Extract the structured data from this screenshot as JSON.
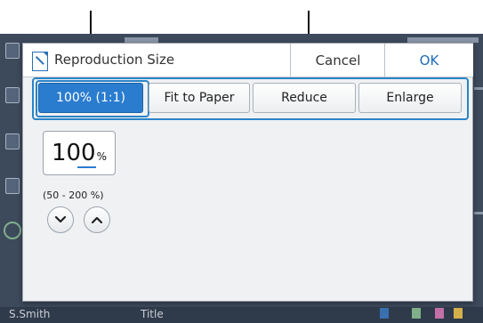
{
  "dialog": {
    "title": "Reproduction Size",
    "cancel_label": "Cancel",
    "ok_label": "OK"
  },
  "options": [
    {
      "label": "100% (1:1)",
      "selected": true
    },
    {
      "label": "Fit to Paper",
      "selected": false
    },
    {
      "label": "Reduce",
      "selected": false
    },
    {
      "label": "Enlarge",
      "selected": false
    }
  ],
  "size": {
    "value": "100",
    "unit": "%",
    "range": "(50 - 200 %)"
  },
  "background": {
    "user": "S.Smith",
    "title": "Title"
  },
  "icons": {
    "title": "reproduction-size-icon",
    "down": "chevron-down-icon",
    "up": "chevron-up-icon"
  },
  "colors": {
    "accent": "#2a7ccf",
    "callout_box": "#2a84c8",
    "ok_text": "#1e6bb8"
  }
}
